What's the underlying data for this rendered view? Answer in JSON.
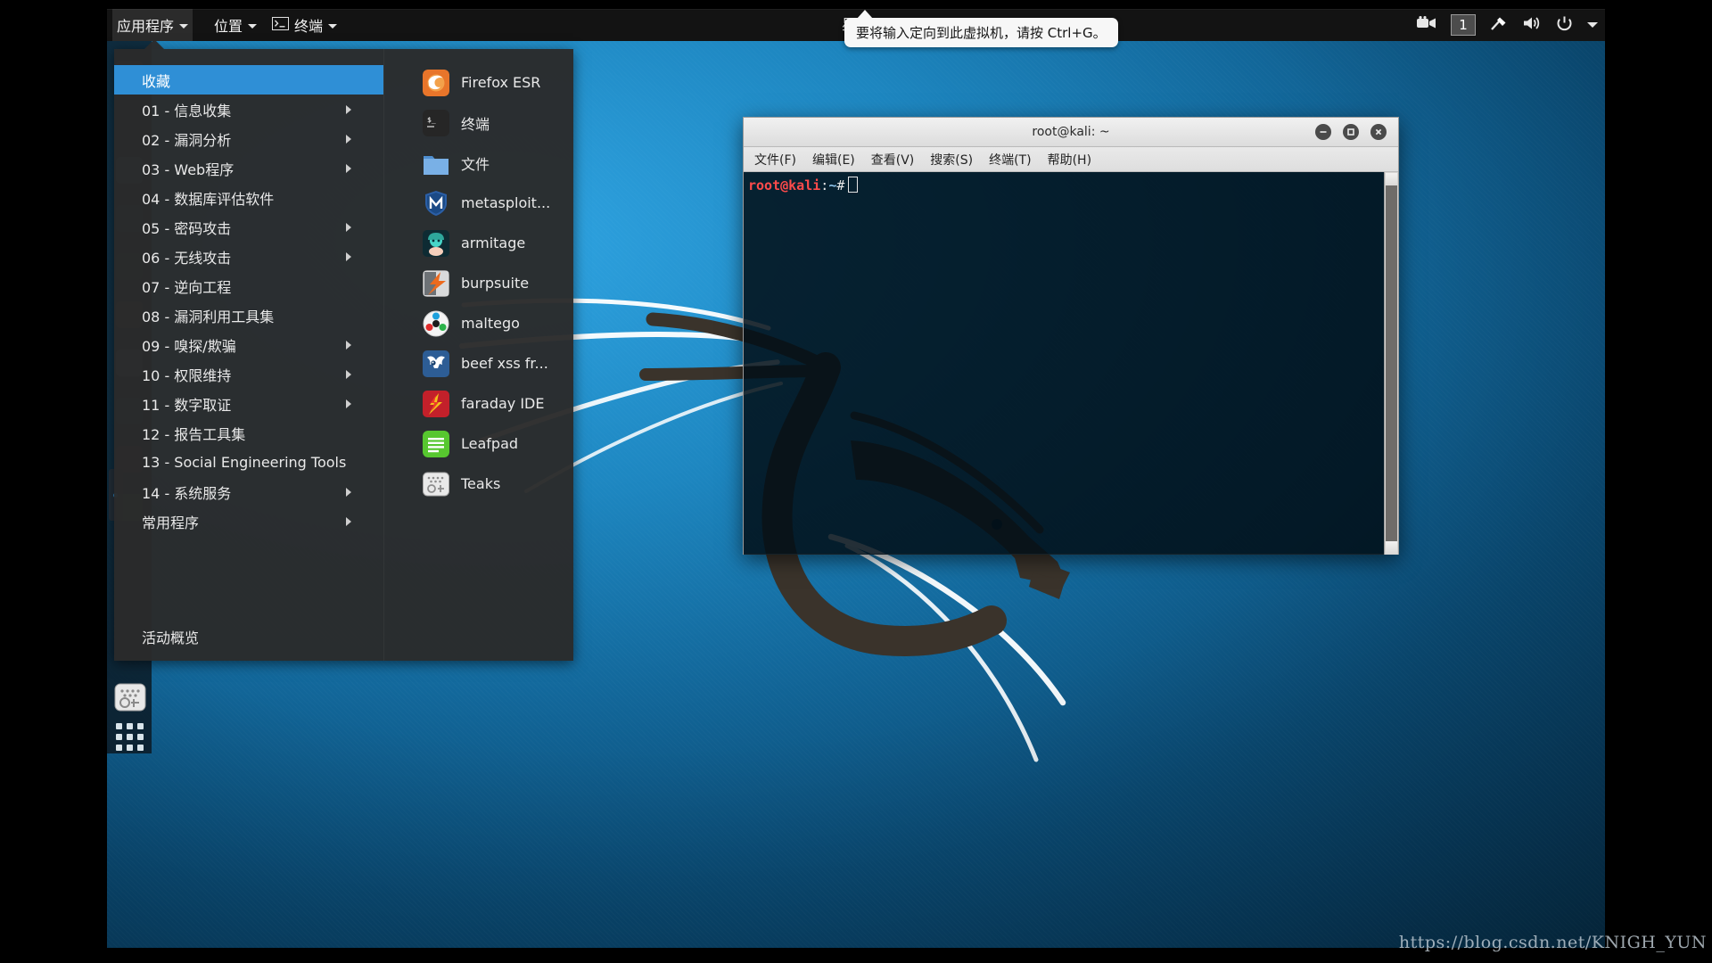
{
  "panel": {
    "applications_label": "应用程序",
    "places_label": "位置",
    "terminal_label": "终端",
    "clock": "星期",
    "workspace_label": "1",
    "icons": [
      "terminal-icon",
      "screencast-icon",
      "workspace-indicator",
      "network-icon",
      "volume-icon",
      "power-icon",
      "system-menu-caret"
    ]
  },
  "tooltip": {
    "text": "要将输入定向到此虚拟机，请按 Ctrl+G。"
  },
  "menu": {
    "categories": [
      {
        "label": "收藏",
        "submenu": false,
        "selected": true
      },
      {
        "label": "01 - 信息收集",
        "submenu": true,
        "selected": false
      },
      {
        "label": "02 - 漏洞分析",
        "submenu": true,
        "selected": false
      },
      {
        "label": "03 - Web程序",
        "submenu": true,
        "selected": false
      },
      {
        "label": "04 - 数据库评估软件",
        "submenu": false,
        "selected": false
      },
      {
        "label": "05 - 密码攻击",
        "submenu": true,
        "selected": false
      },
      {
        "label": "06 - 无线攻击",
        "submenu": true,
        "selected": false
      },
      {
        "label": "07 - 逆向工程",
        "submenu": false,
        "selected": false
      },
      {
        "label": "08 - 漏洞利用工具集",
        "submenu": false,
        "selected": false
      },
      {
        "label": "09 - 嗅探/欺骗",
        "submenu": true,
        "selected": false
      },
      {
        "label": "10 - 权限维持",
        "submenu": true,
        "selected": false
      },
      {
        "label": "11 - 数字取证",
        "submenu": true,
        "selected": false
      },
      {
        "label": "12 - 报告工具集",
        "submenu": false,
        "selected": false
      },
      {
        "label": "13 - Social Engineering Tools",
        "submenu": false,
        "selected": false
      },
      {
        "label": "14 - 系统服务",
        "submenu": true,
        "selected": false
      },
      {
        "label": "常用程序",
        "submenu": true,
        "selected": false
      }
    ],
    "overview_label": "活动概览",
    "favorites": [
      {
        "label": "Firefox ESR",
        "icon": "firefox-icon"
      },
      {
        "label": "终端",
        "icon": "terminal-icon"
      },
      {
        "label": "文件",
        "icon": "files-folder-icon"
      },
      {
        "label": "metasploit...",
        "icon": "metasploit-icon"
      },
      {
        "label": "armitage",
        "icon": "armitage-icon"
      },
      {
        "label": "burpsuite",
        "icon": "burpsuite-icon"
      },
      {
        "label": "maltego",
        "icon": "maltego-icon"
      },
      {
        "label": "beef xss fr...",
        "icon": "beef-icon"
      },
      {
        "label": "faraday IDE",
        "icon": "faraday-icon"
      },
      {
        "label": "Leafpad",
        "icon": "leafpad-icon"
      },
      {
        "label": "Teaks",
        "icon": "teaks-icon"
      }
    ]
  },
  "terminal": {
    "title": "root@kali: ~",
    "menus": [
      "文件(F)",
      "编辑(E)",
      "查看(V)",
      "搜索(S)",
      "终端(T)",
      "帮助(H)"
    ],
    "prompt": {
      "user_host": "root@kali",
      "colon": ":",
      "path": "~",
      "sigil": "#"
    },
    "window_buttons": [
      "minimize-button",
      "maximize-button",
      "close-button"
    ]
  },
  "watermark": "https://blog.csdn.net/KNIGH_YUN",
  "colors": {
    "accent_blue": "#2f8fd6",
    "panel_bg": "#131313",
    "menu_bg": "#2b2b2b",
    "prompt_red": "#ff4b4b",
    "prompt_path_blue": "#8fc4ea",
    "desktop_blue": "#1d86c0"
  }
}
